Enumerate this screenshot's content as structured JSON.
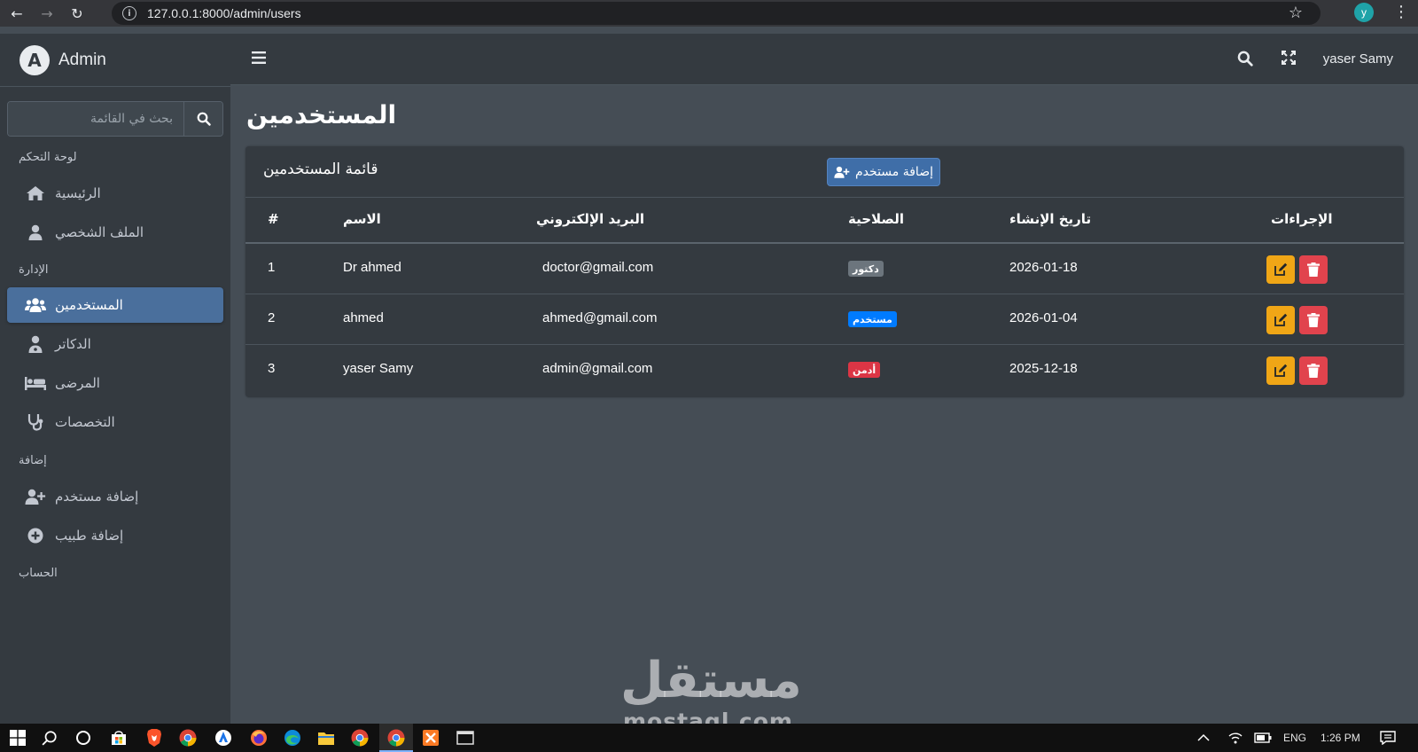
{
  "browser": {
    "url": "127.0.0.1:8000/admin/users",
    "profile_initial": "y"
  },
  "sidebar": {
    "brand": "Admin",
    "search_placeholder": "بحث في القائمة",
    "sections": {
      "dashboard": "لوحة التحكم",
      "management": "الإدارة",
      "add": "إضافة",
      "account": "الحساب"
    },
    "items": {
      "home": "الرئيسية",
      "profile": "الملف الشخصي",
      "users": "المستخدمين",
      "doctors": "الدكاتر",
      "patients": "المرضى",
      "specialties": "التخصصات",
      "add_user": "إضافة مستخدم",
      "add_doctor": "إضافة طبيب"
    }
  },
  "topbar": {
    "user_name": "yaser Samy"
  },
  "page": {
    "title": "المستخدمين",
    "card_title": "قائمة المستخدمين",
    "add_button": "إضافة مستخدم"
  },
  "table": {
    "headers": {
      "num": "#",
      "name": "الاسم",
      "email": "البريد الإلكتروني",
      "role": "الصلاحية",
      "created": "تاريخ الإنشاء",
      "actions": "الإجراءات"
    },
    "rows": [
      {
        "num": "1",
        "name": "Dr ahmed",
        "email": "doctor@gmail.com",
        "role": "دكتور",
        "created": "2026-01-18"
      },
      {
        "num": "2",
        "name": "ahmed",
        "email": "ahmed@gmail.com",
        "role": "مستخدم",
        "created": "2026-01-04"
      },
      {
        "num": "3",
        "name": "yaser Samy",
        "email": "admin@gmail.com",
        "role": "أدمن",
        "created": "2025-12-18"
      }
    ]
  },
  "colors": {
    "badge_doctor": "#6c757d",
    "badge_user": "#007bff",
    "badge_admin": "#dc3545",
    "edit_button": "#f0a616",
    "delete_button": "#e1434d",
    "active_nav": "#4a6f9c"
  },
  "watermark": {
    "arabic": "مستقل",
    "latin": "mostaql.com"
  },
  "taskbar": {
    "language": "ENG",
    "time": "1:26 PM"
  }
}
